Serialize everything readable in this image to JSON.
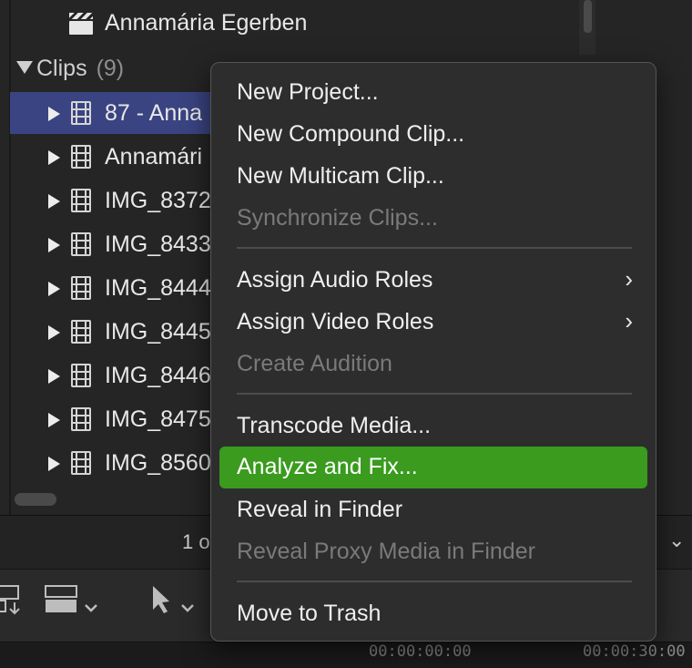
{
  "browser": {
    "event_item": {
      "label": "Annamária Egerben",
      "icon": "clapperboard-icon"
    },
    "group": {
      "title": "Clips",
      "count": "(9)"
    },
    "clips": [
      {
        "label": "87 - Anna",
        "selected": true
      },
      {
        "label": "Annamári",
        "selected": false
      },
      {
        "label": "IMG_8372",
        "selected": false
      },
      {
        "label": "IMG_8433",
        "selected": false
      },
      {
        "label": "IMG_8444",
        "selected": false
      },
      {
        "label": "IMG_8445",
        "selected": false
      },
      {
        "label": "IMG_8446",
        "selected": false
      },
      {
        "label": "IMG_8475",
        "selected": false
      },
      {
        "label": "IMG_8560",
        "selected": false
      }
    ]
  },
  "status": {
    "text": "1 o"
  },
  "timeline": {
    "tc1": "00:00:00:00",
    "tc2": "00:00:30:00"
  },
  "context_menu": {
    "items": [
      {
        "label": "New Project...",
        "enabled": true
      },
      {
        "label": "New Compound Clip...",
        "enabled": true
      },
      {
        "label": "New Multicam Clip...",
        "enabled": true
      },
      {
        "label": "Synchronize Clips...",
        "enabled": false
      },
      {
        "label": "Assign Audio Roles",
        "enabled": true,
        "submenu": true
      },
      {
        "label": "Assign Video Roles",
        "enabled": true,
        "submenu": true
      },
      {
        "label": "Create Audition",
        "enabled": false
      },
      {
        "label": "Transcode Media...",
        "enabled": true
      },
      {
        "label": "Analyze and Fix...",
        "enabled": true,
        "highlighted": true
      },
      {
        "label": "Reveal in Finder",
        "enabled": true
      },
      {
        "label": "Reveal Proxy Media in Finder",
        "enabled": false
      },
      {
        "label": "Move to Trash",
        "enabled": true
      }
    ],
    "highlight_color": "#3a9b1f"
  }
}
